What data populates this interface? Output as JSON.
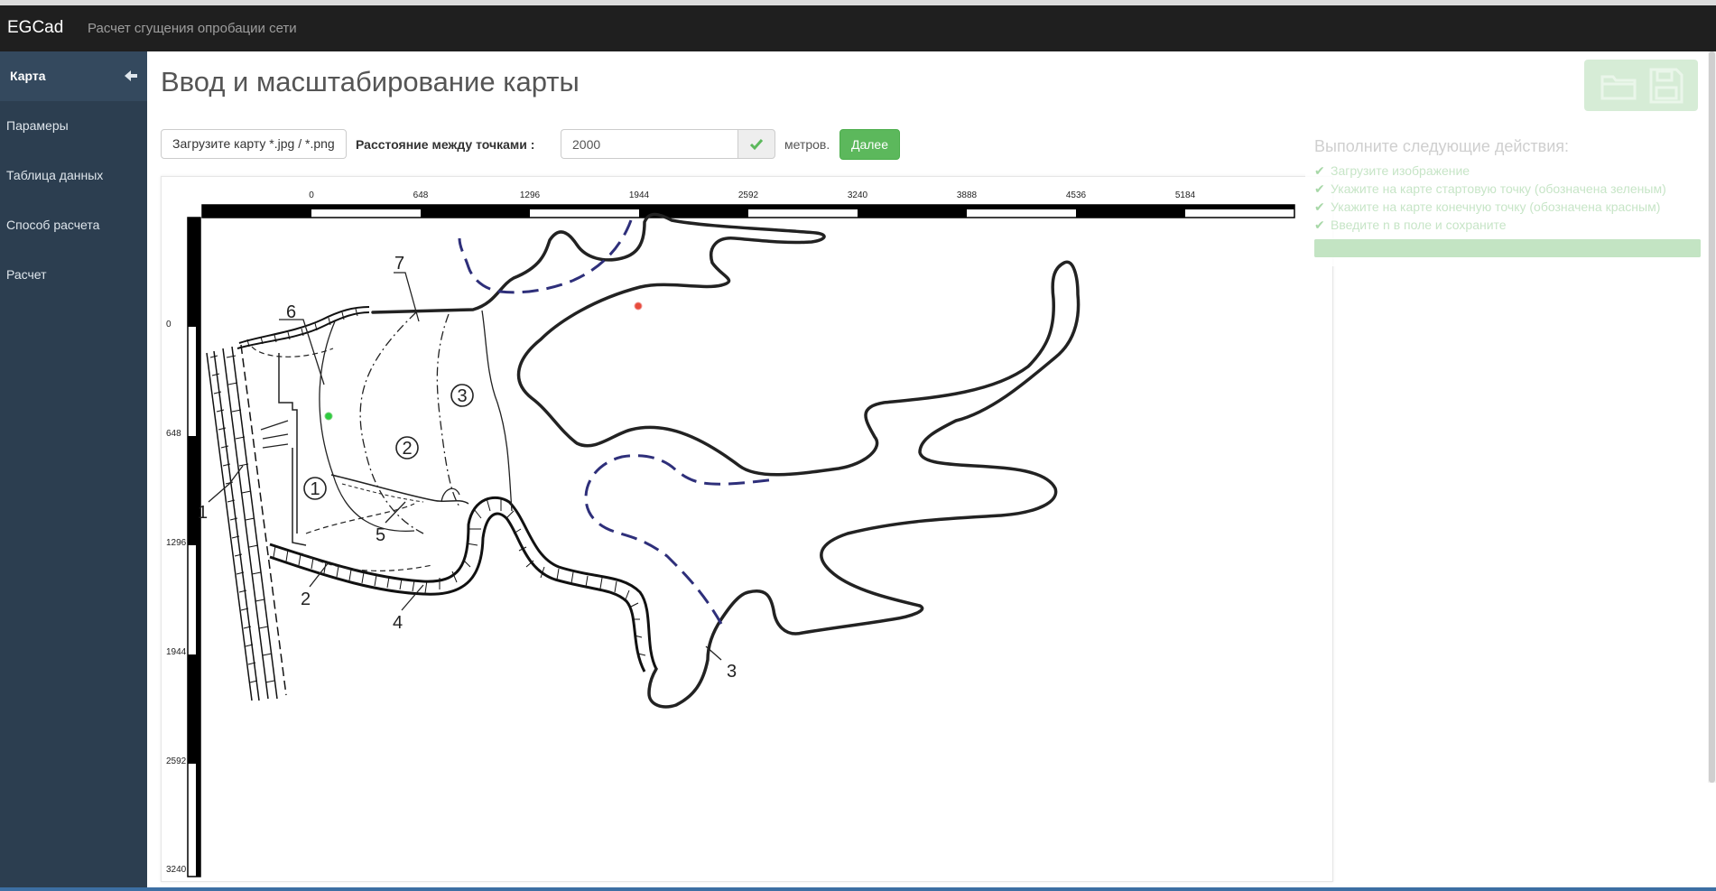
{
  "app": {
    "brand": "EGCad",
    "subtitle": "Расчет сгущения опробации сети"
  },
  "sidebar": {
    "collapse_icon": "arrow-left-icon",
    "items": [
      {
        "label": "Карта",
        "active": true
      },
      {
        "label": "Парамеры",
        "active": false
      },
      {
        "label": "Таблица данных",
        "active": false
      },
      {
        "label": "Способ расчета",
        "active": false
      },
      {
        "label": "Расчет",
        "active": false
      }
    ]
  },
  "page": {
    "title": "Ввод и масштабирование карты"
  },
  "toolbar": {
    "upload_label": "Загрузите карту *.jpg / *.png",
    "distance_label": "Расстояние между точками :",
    "distance_value": "2000",
    "confirm_icon": "check-icon",
    "units": "метров.",
    "next_label": "Далее",
    "open_icon": "folder-icon",
    "save_icon": "floppy-disk-icon"
  },
  "map": {
    "x_scale_labels": [
      "0",
      "648",
      "1296",
      "1944",
      "2592",
      "3240",
      "3888",
      "4536",
      "5184"
    ],
    "y_scale_labels": [
      "0",
      "648",
      "1296",
      "1944",
      "2592",
      "3240"
    ],
    "feature_labels": [
      "1",
      "2",
      "3",
      "4",
      "5",
      "6",
      "7"
    ],
    "zone_labels": [
      "1",
      "2",
      "3"
    ],
    "start_point_color": "#2ecc40",
    "end_point_color": "#e74c3c"
  },
  "instructions": {
    "title": "Выполните следующие действия:",
    "steps": [
      "Загрузите изображение",
      "Укажите на карте стартовую точку (обозначена зеленым)",
      "Укажите на карте конечную точку (обозначена красным)",
      "Введите n в поле и сохраните"
    ],
    "progress_percent": 100
  },
  "colors": {
    "navbar": "#1f1f1f",
    "sidebar": "#2c3e50",
    "success": "#5cb85c"
  }
}
